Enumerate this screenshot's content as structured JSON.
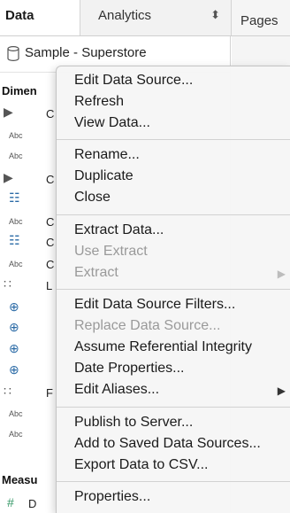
{
  "tabs": {
    "data": "Data",
    "analytics": "Analytics",
    "pages": "Pages"
  },
  "datasource": {
    "name": "Sample - Superstore"
  },
  "left": {
    "dimensions_label": "Dimen",
    "measures_label": "Measu",
    "rows": [
      {
        "icon": "▶",
        "text": "C"
      },
      {
        "icon": "Abc",
        "text": ""
      },
      {
        "icon": "Abc",
        "text": ""
      },
      {
        "icon": "▶",
        "text": "C"
      },
      {
        "icon": "☷",
        "text": ""
      },
      {
        "icon": "Abc",
        "text": "C"
      },
      {
        "icon": "☷",
        "text": "C"
      },
      {
        "icon": "Abc",
        "text": "C"
      },
      {
        "icon": "∷",
        "text": "L"
      },
      {
        "icon": "⊕",
        "text": ""
      },
      {
        "icon": "⊕",
        "text": ""
      },
      {
        "icon": "⊕",
        "text": ""
      },
      {
        "icon": "⊕",
        "text": ""
      },
      {
        "icon": "∷",
        "text": "F"
      },
      {
        "icon": "Abc",
        "text": ""
      },
      {
        "icon": "Abc",
        "text": ""
      }
    ],
    "measure_row": {
      "icon": "#",
      "text": "D"
    }
  },
  "menu": {
    "items": [
      {
        "label": "Edit Data Source...",
        "enabled": true
      },
      {
        "label": "Refresh",
        "enabled": true
      },
      {
        "label": "View Data...",
        "enabled": true
      },
      {
        "label": "Rename...",
        "enabled": true
      },
      {
        "label": "Duplicate",
        "enabled": true
      },
      {
        "label": "Close",
        "enabled": true
      },
      {
        "label": "Extract Data...",
        "enabled": true
      },
      {
        "label": "Use Extract",
        "enabled": false
      },
      {
        "label": "Extract",
        "enabled": false,
        "submenu": true
      },
      {
        "label": "Edit Data Source Filters...",
        "enabled": true
      },
      {
        "label": "Replace Data Source...",
        "enabled": false
      },
      {
        "label": "Assume Referential Integrity",
        "enabled": true
      },
      {
        "label": "Date Properties...",
        "enabled": true
      },
      {
        "label": "Edit Aliases...",
        "enabled": true,
        "submenu": true
      },
      {
        "label": "Publish to Server...",
        "enabled": true
      },
      {
        "label": "Add to Saved Data Sources...",
        "enabled": true
      },
      {
        "label": "Export Data to CSV...",
        "enabled": true
      },
      {
        "label": "Properties...",
        "enabled": true
      }
    ],
    "submenu_arrow": "▶"
  },
  "colors": {
    "accent": "#2a6aa6",
    "disabled": "#9a9a9a",
    "menu_bg": "#f6f6f6"
  },
  "icons": {
    "database": "database-icon",
    "dropdown": "dropdown-arrows-icon"
  }
}
